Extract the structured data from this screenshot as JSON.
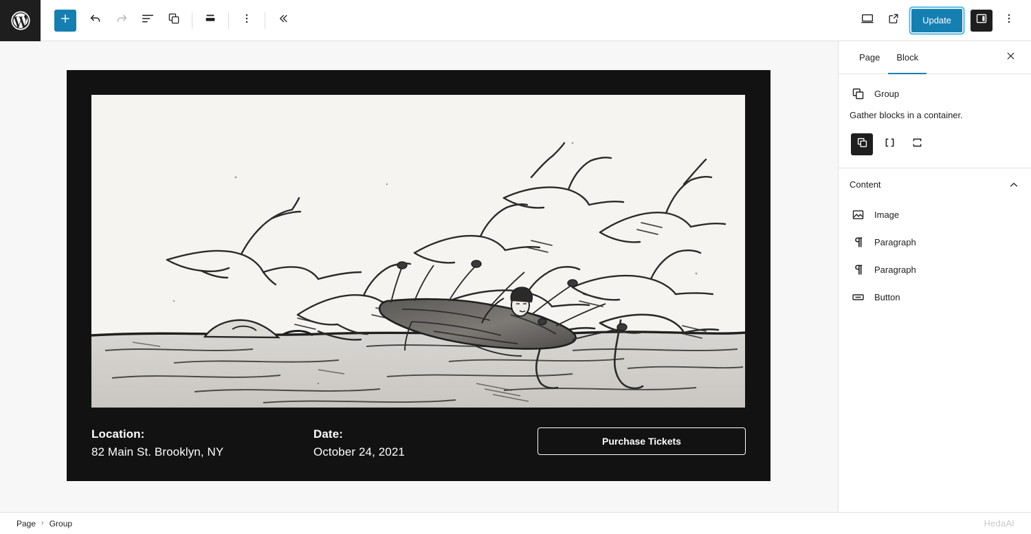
{
  "toolbar": {
    "logo_icon": "wordpress-logo-icon",
    "add_block_label": "+",
    "add_block_icon": "plus-icon",
    "undo_icon": "undo-icon",
    "redo_icon": "redo-icon",
    "list_view_icon": "list-view-icon",
    "block_icon": "group-block-icon",
    "align_icon": "block-align-icon",
    "options_icon": "more-options-icon",
    "collapse_icon": "double-chevron-left-icon",
    "view_icon": "desktop-view-icon",
    "preview_icon": "external-link-icon",
    "update_label": "Update",
    "settings_icon": "settings-sidebar-icon",
    "more_icon": "more-menu-icon",
    "accent_color": "#157fb2",
    "focus_ring_color": "#4eb8e8",
    "dark_color": "#1e1e1e"
  },
  "editor": {
    "group": {
      "background_color": "#121212",
      "text_color": "#ffffff",
      "image_alt": "ink-drawing-cranes-carrying-figure-over-water",
      "location_label": "Location:",
      "location_value": "82 Main St. Brooklyn, NY",
      "date_label": "Date:",
      "date_value": "October 24, 2021",
      "cta_label": "Purchase Tickets"
    }
  },
  "settings": {
    "tabs": [
      {
        "label": "Page",
        "active": false
      },
      {
        "label": "Block",
        "active": true
      }
    ],
    "close_icon": "close-icon",
    "block": {
      "icon": "group-block-icon",
      "title": "Group",
      "description": "Gather blocks in a container.",
      "variations": [
        {
          "name": "group-variation",
          "icon": "group-icon",
          "selected": true
        },
        {
          "name": "row-variation",
          "icon": "row-icon",
          "selected": false
        },
        {
          "name": "stack-variation",
          "icon": "stack-icon",
          "selected": false
        }
      ]
    },
    "content_panel": {
      "title": "Content",
      "expanded": true,
      "chevron_icon": "chevron-up-icon",
      "items": [
        {
          "label": "Image",
          "icon": "image-icon"
        },
        {
          "label": "Paragraph",
          "icon": "paragraph-icon"
        },
        {
          "label": "Paragraph",
          "icon": "paragraph-icon"
        },
        {
          "label": "Button",
          "icon": "button-icon"
        }
      ]
    }
  },
  "footer": {
    "breadcrumbs": [
      {
        "label": "Page"
      },
      {
        "label": "Group"
      }
    ],
    "separator": "›",
    "watermark": "HedaAI"
  }
}
